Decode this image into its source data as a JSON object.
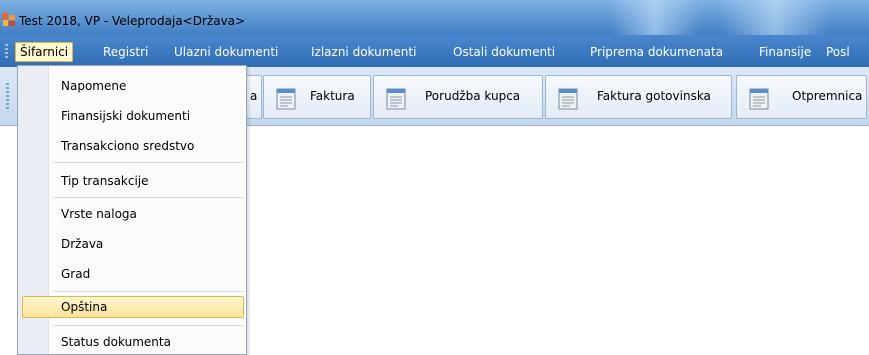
{
  "window": {
    "title": "Test 2018, VP - Veleprodaja<Država>"
  },
  "menubar": {
    "items": [
      {
        "label": "Šifarnici",
        "active": true
      },
      {
        "label": "Registri"
      },
      {
        "label": "Ulazni dokumenti"
      },
      {
        "label": "Izlazni dokumenti"
      },
      {
        "label": "Ostali dokumenti"
      },
      {
        "label": "Priprema dokumenata"
      },
      {
        "label": "Finansije"
      },
      {
        "label": "Posl"
      }
    ]
  },
  "toolbar": {
    "buttons": [
      {
        "label": "a"
      },
      {
        "label": "Faktura"
      },
      {
        "label": "Porudžba kupca"
      },
      {
        "label": "Faktura gotovinska"
      },
      {
        "label": "Otpremnica"
      }
    ]
  },
  "dropdown": {
    "items": [
      {
        "label": "Napomene"
      },
      {
        "label": "Finansijski dokumenti"
      },
      {
        "label": "Transakciono sredstvo"
      },
      {
        "label": "Tip transakcije"
      },
      {
        "label": "Vrste naloga"
      },
      {
        "label": "Država"
      },
      {
        "label": "Grad"
      },
      {
        "label": "Opština",
        "highlighted": true
      },
      {
        "label": "Status dokumenta"
      }
    ]
  },
  "colors": {
    "titlebar": "#6a9fd7",
    "menubar": "#2f6db5",
    "highlight": "#fbe49c"
  },
  "icons": {
    "app": "app-logo-icon",
    "toolbar": "document-icon"
  }
}
